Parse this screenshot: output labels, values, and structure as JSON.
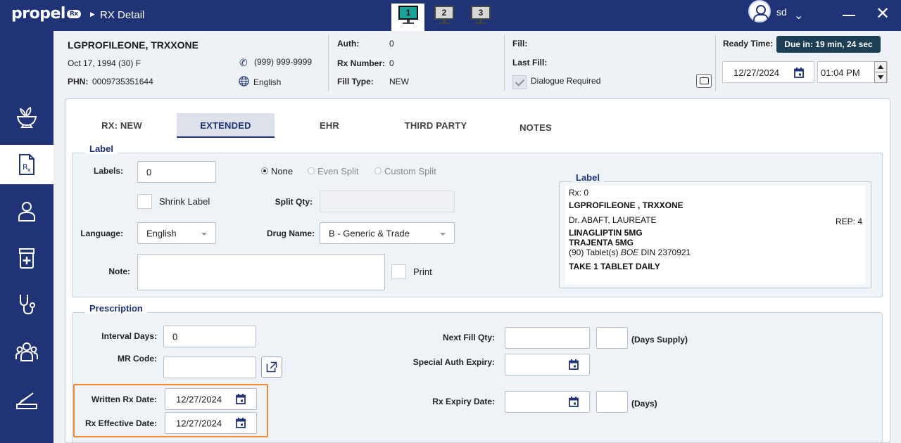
{
  "app": {
    "logo": "propel",
    "logo_badge": "Rx",
    "breadcrumb": "RX Detail"
  },
  "workspaces": [
    "1",
    "2",
    "3"
  ],
  "user": {
    "name": "sd"
  },
  "patient": {
    "name": "LGPROFILEONE, TRXXONE",
    "dob": "Oct 17, 1994 (30) F",
    "phn_label": "PHN:",
    "phn": "0009735351644",
    "phone": "(999) 999-9999",
    "language": "English"
  },
  "auth": {
    "auth_label": "Auth:",
    "auth_value": "0",
    "rx_number_label": "Rx Number:",
    "rx_number_value": "0",
    "fill_type_label": "Fill Type:",
    "fill_type_value": "NEW"
  },
  "fill": {
    "fill_label": "Fill:",
    "last_fill_label": "Last Fill:",
    "dialogue_label": "Dialogue Required"
  },
  "ready": {
    "label": "Ready Time:",
    "due": "Due in: 19 min, 24 sec",
    "date": "12/27/2024",
    "time": "01:04 PM"
  },
  "tabs": [
    "RX: NEW",
    "EXTENDED",
    "EHR",
    "THIRD PARTY",
    "NOTES"
  ],
  "label_section": {
    "title": "Label",
    "labels_label": "Labels:",
    "labels_value": "0",
    "split_options": [
      "None",
      "Even Split",
      "Custom Split"
    ],
    "shrink_label": "Shrink Label",
    "split_qty_label": "Split Qty:",
    "language_label": "Language:",
    "language_value": "English",
    "drug_name_label": "Drug Name:",
    "drug_name_value": "B  -  Generic & Trade",
    "note_label": "Note:",
    "print_label": "Print"
  },
  "label_preview": {
    "title": "Label",
    "rx": "Rx: 0",
    "patient": "LGPROFILEONE ,  TRXXONE",
    "doctor": "Dr. ABAFT, LAUREATE",
    "rep": "REP: 4",
    "drug_generic": "LINAGLIPTIN 5MG",
    "drug_trade": "TRAJENTA 5MG",
    "qty_prefix": "(90) Tablet(s)",
    "qty_mfr": "BOE",
    "qty_din": "DIN 2370921",
    "sig": "TAKE 1 TABLET DAILY"
  },
  "prescription": {
    "title": "Prescription",
    "interval_days_label": "Interval Days:",
    "interval_days_value": "0",
    "mr_code_label": "MR Code:",
    "written_date_label": "Written Rx Date:",
    "written_date_value": "12/27/2024",
    "effective_date_label": "Rx Effective Date:",
    "effective_date_value": "12/27/2024",
    "next_fill_qty_label": "Next Fill Qty:",
    "days_supply_label": "(Days Supply)",
    "special_auth_label": "Special Auth Expiry:",
    "rx_expiry_label": "Rx Expiry Date:",
    "days_label": "(Days)"
  },
  "colors": {
    "brand": "#1f3376",
    "accent": "#1aa39a",
    "highlight": "#f08a2d",
    "badge": "#1d3f55"
  }
}
